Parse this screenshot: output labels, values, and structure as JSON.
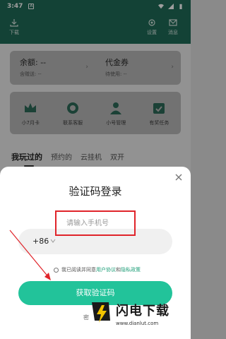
{
  "status_bar": {
    "time": "3:47",
    "badge": "A"
  },
  "topbar": {
    "download_label": "下载",
    "settings_label": "设置",
    "message_label": "消息"
  },
  "wallet": {
    "balance_label": "余额: --",
    "balance_sub": "含赠送: --",
    "coupon_label": "代金券",
    "coupon_sub": "待使用: --",
    "chevron": "›"
  },
  "shortcuts": [
    {
      "label": "小7月卡",
      "icon": "crown-icon"
    },
    {
      "label": "联系客服",
      "icon": "headset-icon"
    },
    {
      "label": "小号管理",
      "icon": "user-manage-icon"
    },
    {
      "label": "有奖任务",
      "icon": "task-calendar-icon"
    }
  ],
  "tabs": [
    "我玩过的",
    "预约的",
    "云挂机",
    "双开"
  ],
  "login": {
    "title": "验证码登录",
    "country_code": "+86",
    "phone_placeholder": "请输入手机号",
    "agree_prefix": "我已阅读并同意",
    "user_agreement": "用户协议",
    "and": "和",
    "privacy_policy": "隐私政策",
    "submit_label": "获取验证码",
    "password_login_partial": "密"
  },
  "watermark": {
    "brand": "闪电下载",
    "url": "www.dianlut.com"
  },
  "colors": {
    "header_bg": "#1f6b57",
    "accent": "#22c39a",
    "link": "#1e9e78",
    "annotation": "#e0242a"
  }
}
